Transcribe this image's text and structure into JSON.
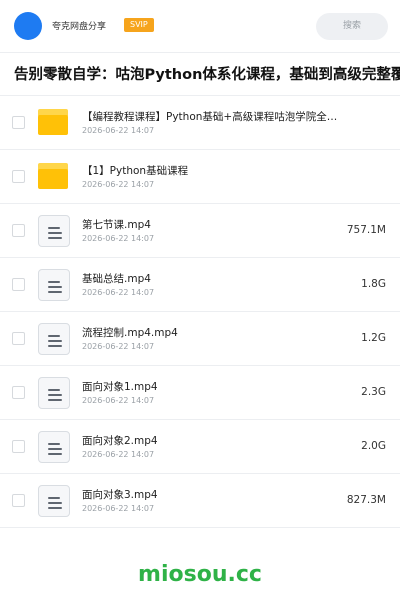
{
  "header": {
    "site_name": "夸克网盘分享",
    "badge": "SVIP",
    "search_placeholder": "搜索"
  },
  "folder": {
    "title": "告别零散自学：咕泡Python体系化课程，基础到高级完整覆盖"
  },
  "items": [
    {
      "type": "folder",
      "name": "【编程教程课程】Python基础+高级课程咕泡学院全套课程",
      "date": "2026-06-22 14:07",
      "size": ""
    },
    {
      "type": "folder",
      "name": "【1】Python基础课程",
      "date": "2026-06-22 14:07",
      "size": ""
    },
    {
      "type": "file",
      "name": "第七节课.mp4",
      "date": "2026-06-22 14:07",
      "size": "757.1M"
    },
    {
      "type": "file",
      "name": "基础总结.mp4",
      "date": "2026-06-22 14:07",
      "size": "1.8G"
    },
    {
      "type": "file",
      "name": "流程控制.mp4.mp4",
      "date": "2026-06-22 14:07",
      "size": "1.2G"
    },
    {
      "type": "file",
      "name": "面向对象1.mp4",
      "date": "2026-06-22 14:07",
      "size": "2.3G"
    },
    {
      "type": "file",
      "name": "面向对象2.mp4",
      "date": "2026-06-22 14:07",
      "size": "2.0G"
    },
    {
      "type": "file",
      "name": "面向对象3.mp4",
      "date": "2026-06-22 14:07",
      "size": "827.3M"
    }
  ],
  "watermark": "miosou.cc",
  "colors": {
    "avatar": "#1e7bf2",
    "badge": "#f6a41c",
    "folder": "#ffc107",
    "watermark": "#2fb247"
  },
  "icons": {
    "folder": "folder-icon",
    "file": "document-icon"
  }
}
